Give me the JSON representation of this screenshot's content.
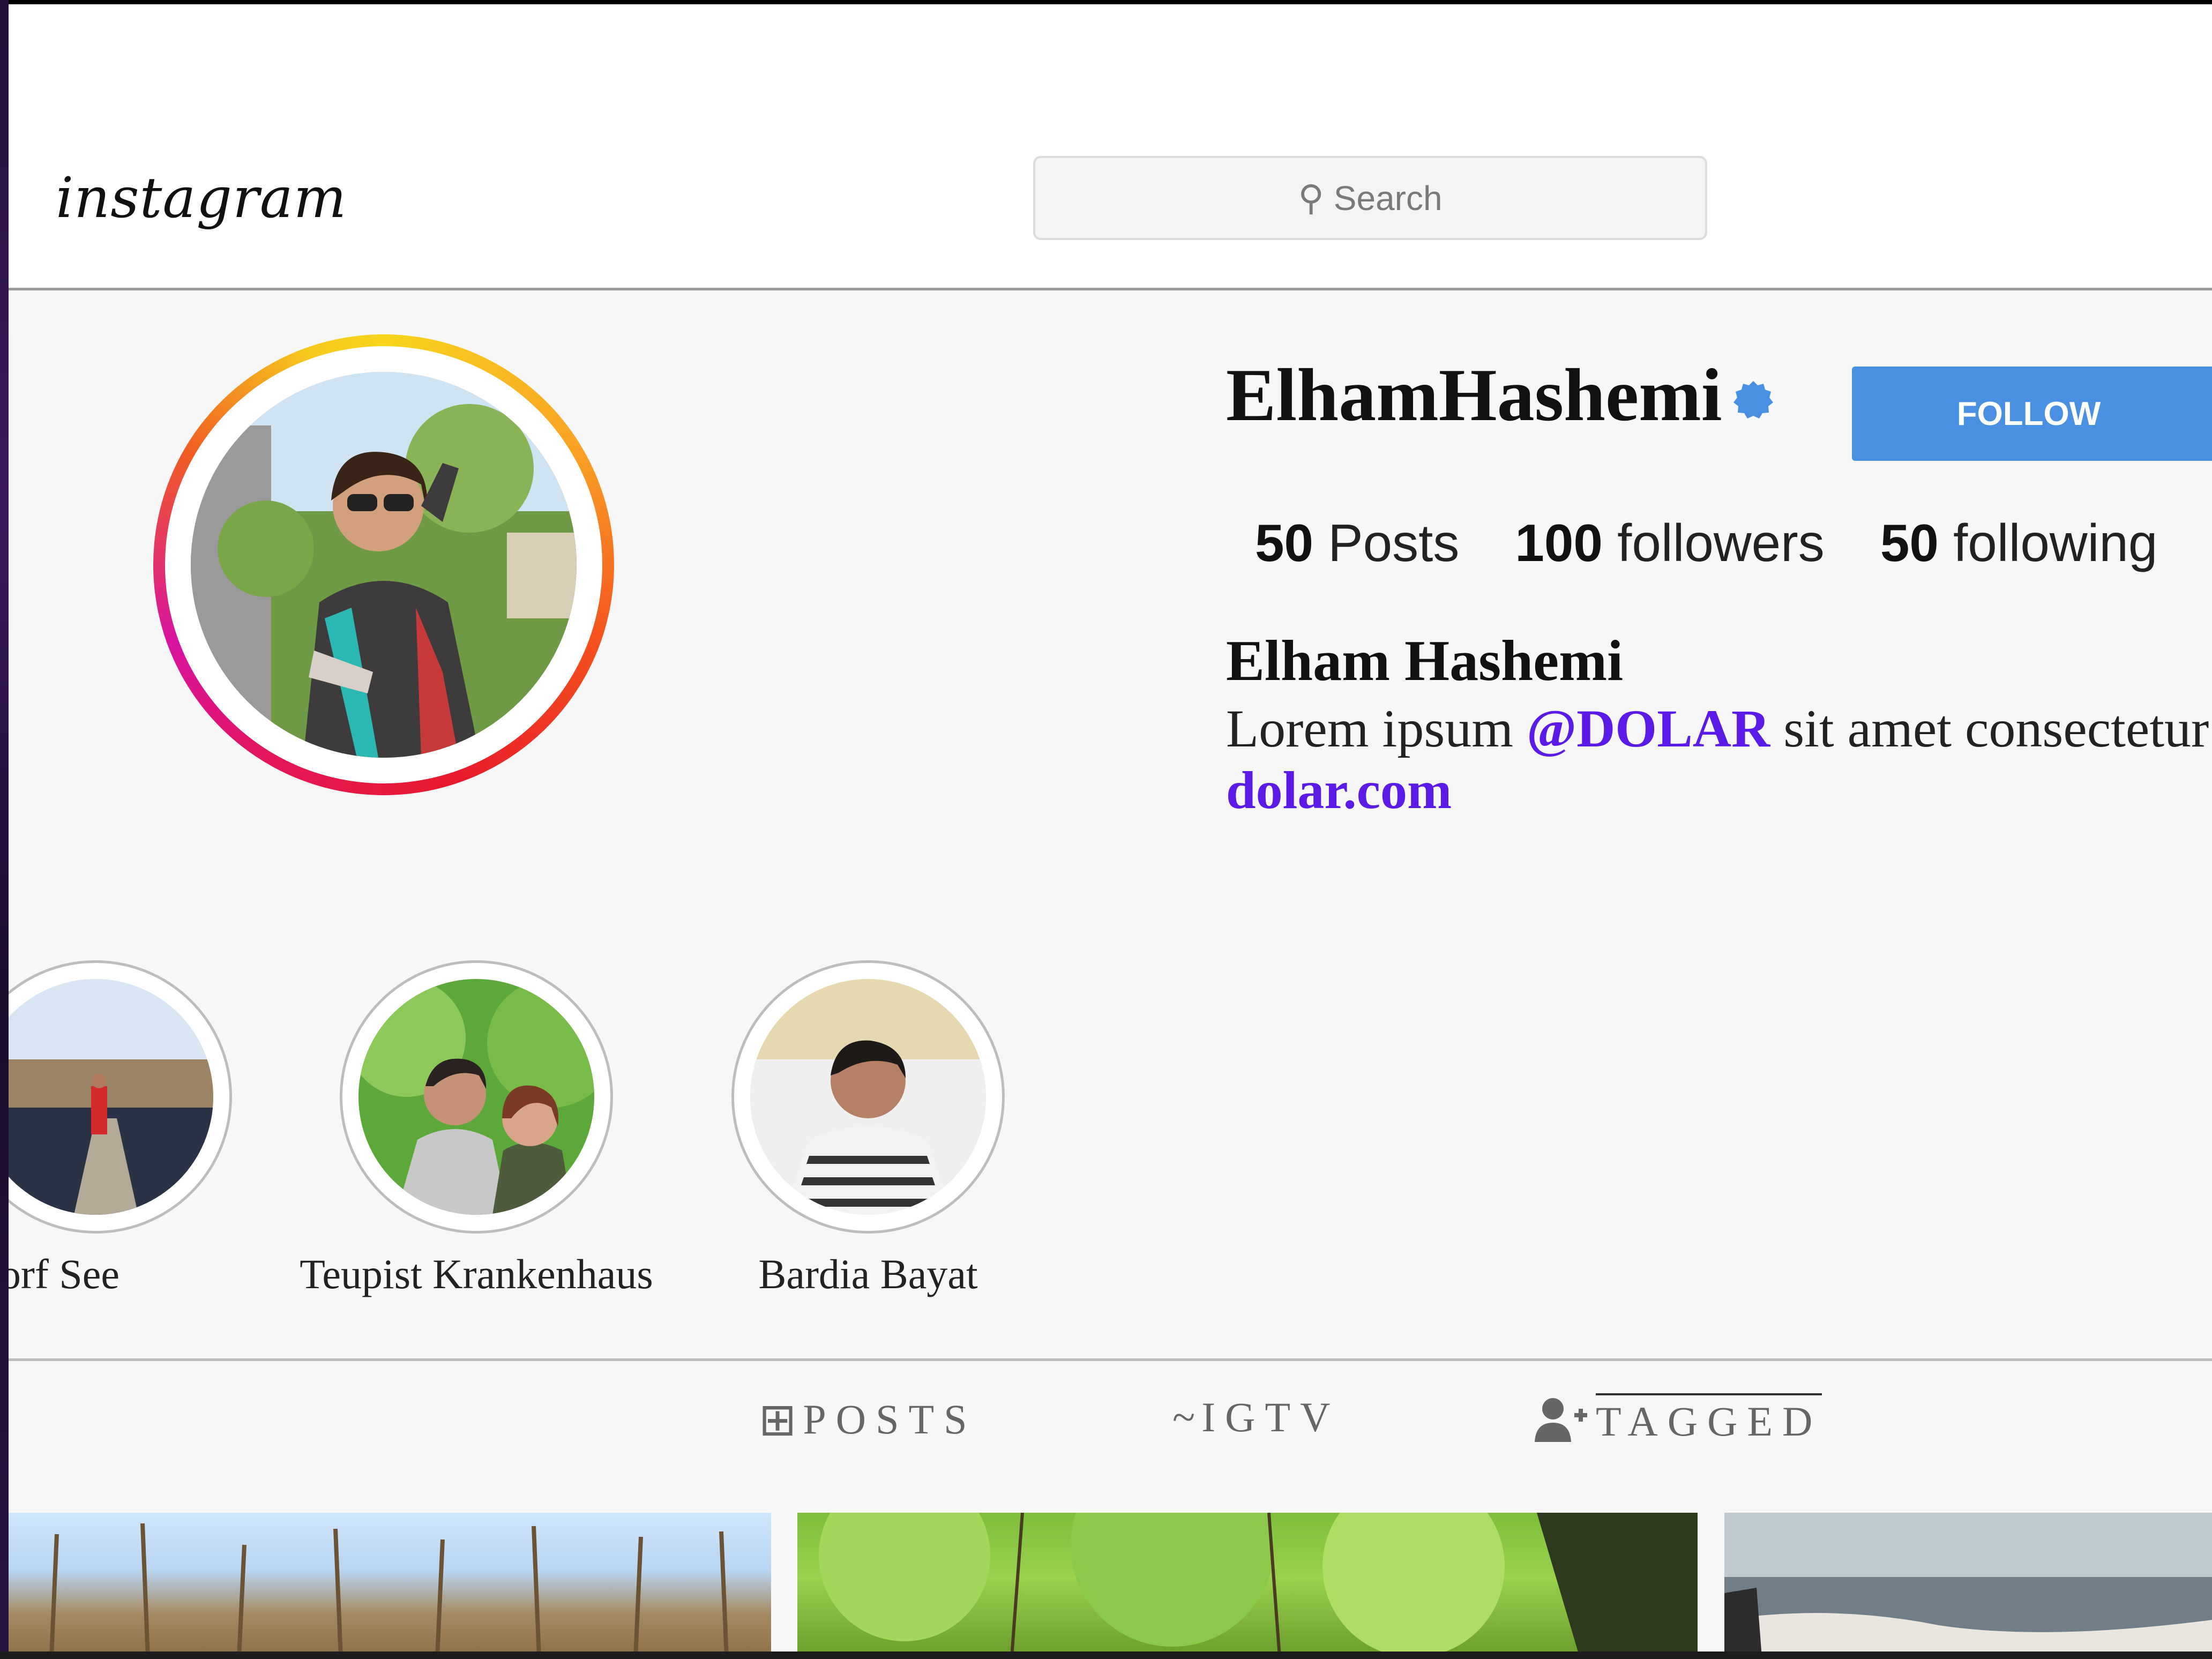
{
  "header": {
    "logo_text": "instagram",
    "search_placeholder": "Search",
    "search_icon": "location-pin-icon"
  },
  "profile": {
    "username": "ElhamHashemi",
    "verified_icon": "verified-badge-icon",
    "follow_label": "FOLLOW",
    "stats": {
      "posts_count": "50",
      "posts_label": "Posts",
      "followers_count": "100",
      "followers_label": "followers",
      "following_count": "50",
      "following_label": "following"
    },
    "full_name": "Elham Hashemi",
    "bio": {
      "before_mention": "Lorem ipsum ",
      "mention": "@DOLAR",
      "after_mention": " sit amet consectetur"
    },
    "link": "dolar.com"
  },
  "highlights": [
    {
      "label": "insdorf See"
    },
    {
      "label": "Teupist Krankenhaus"
    },
    {
      "label": "Bardia Bayat"
    }
  ],
  "tabs": [
    {
      "label": "POSTS",
      "icon": "grid-icon",
      "icon_glyph": "⊞"
    },
    {
      "label": "IGTV",
      "icon": "tilde-icon",
      "icon_glyph": "~"
    },
    {
      "label": "TAGGED",
      "icon": "user-plus-icon"
    }
  ],
  "colors": {
    "follow_button": "#4a90e2",
    "mention_link": "#5b1be6",
    "verified_badge": "#4a90e2"
  }
}
